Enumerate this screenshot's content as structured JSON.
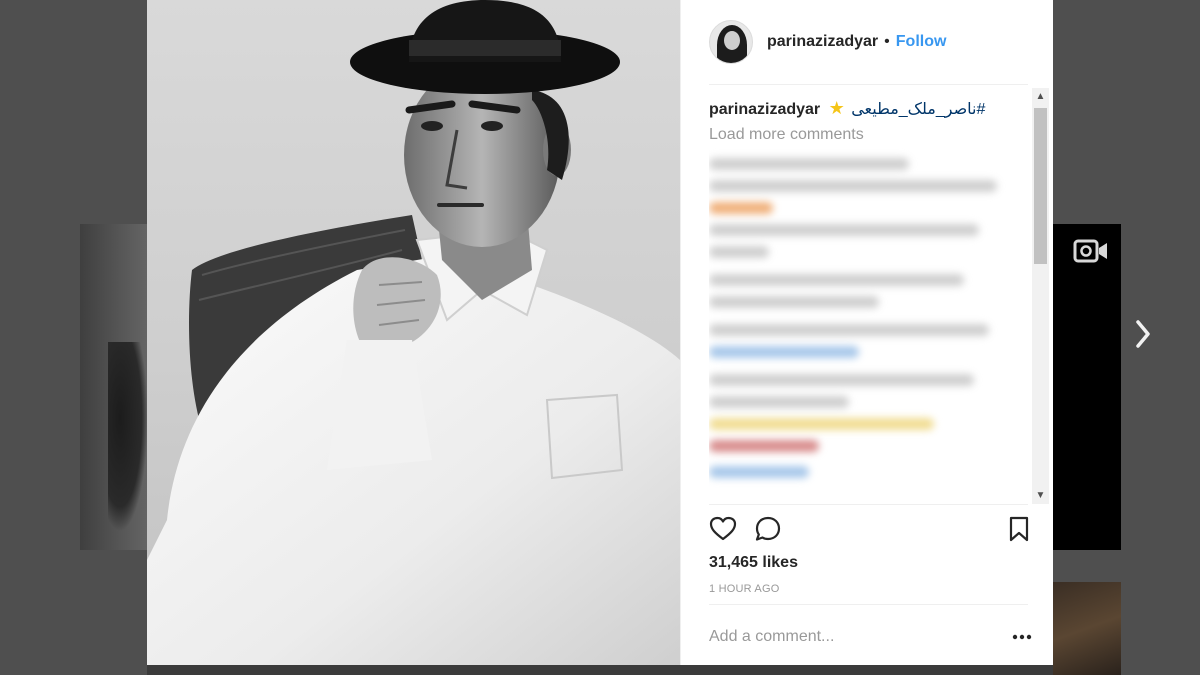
{
  "post": {
    "username": "parinazizadyar",
    "separator": "•",
    "follow_label": "Follow",
    "photo_icon": "black-and-white-portrait-man-in-hat"
  },
  "comments": {
    "caption_user": "parinazizadyar",
    "caption_emoji": "★",
    "caption_hashtag": "ناصر_ملک_مطیعی#",
    "load_more_label": "Load more comments",
    "blurred_comments_visible": true
  },
  "actions": {
    "like_icon": "heart-icon",
    "comment_icon": "comment-icon",
    "save_icon": "bookmark-icon"
  },
  "stats": {
    "likes_label": "31,465 likes",
    "timestamp": "1 HOUR AGO"
  },
  "composer": {
    "placeholder": "Add a comment...",
    "more_icon": "more-options-icon"
  },
  "navigation": {
    "next_icon": "chevron-right-icon",
    "video_badge_icon": "video-icon"
  },
  "colors": {
    "overlay_bg": "#4f4f4f",
    "link_blue": "#3897f0",
    "hashtag_blue": "#003569",
    "text_primary": "#262626",
    "text_muted": "#999999"
  }
}
